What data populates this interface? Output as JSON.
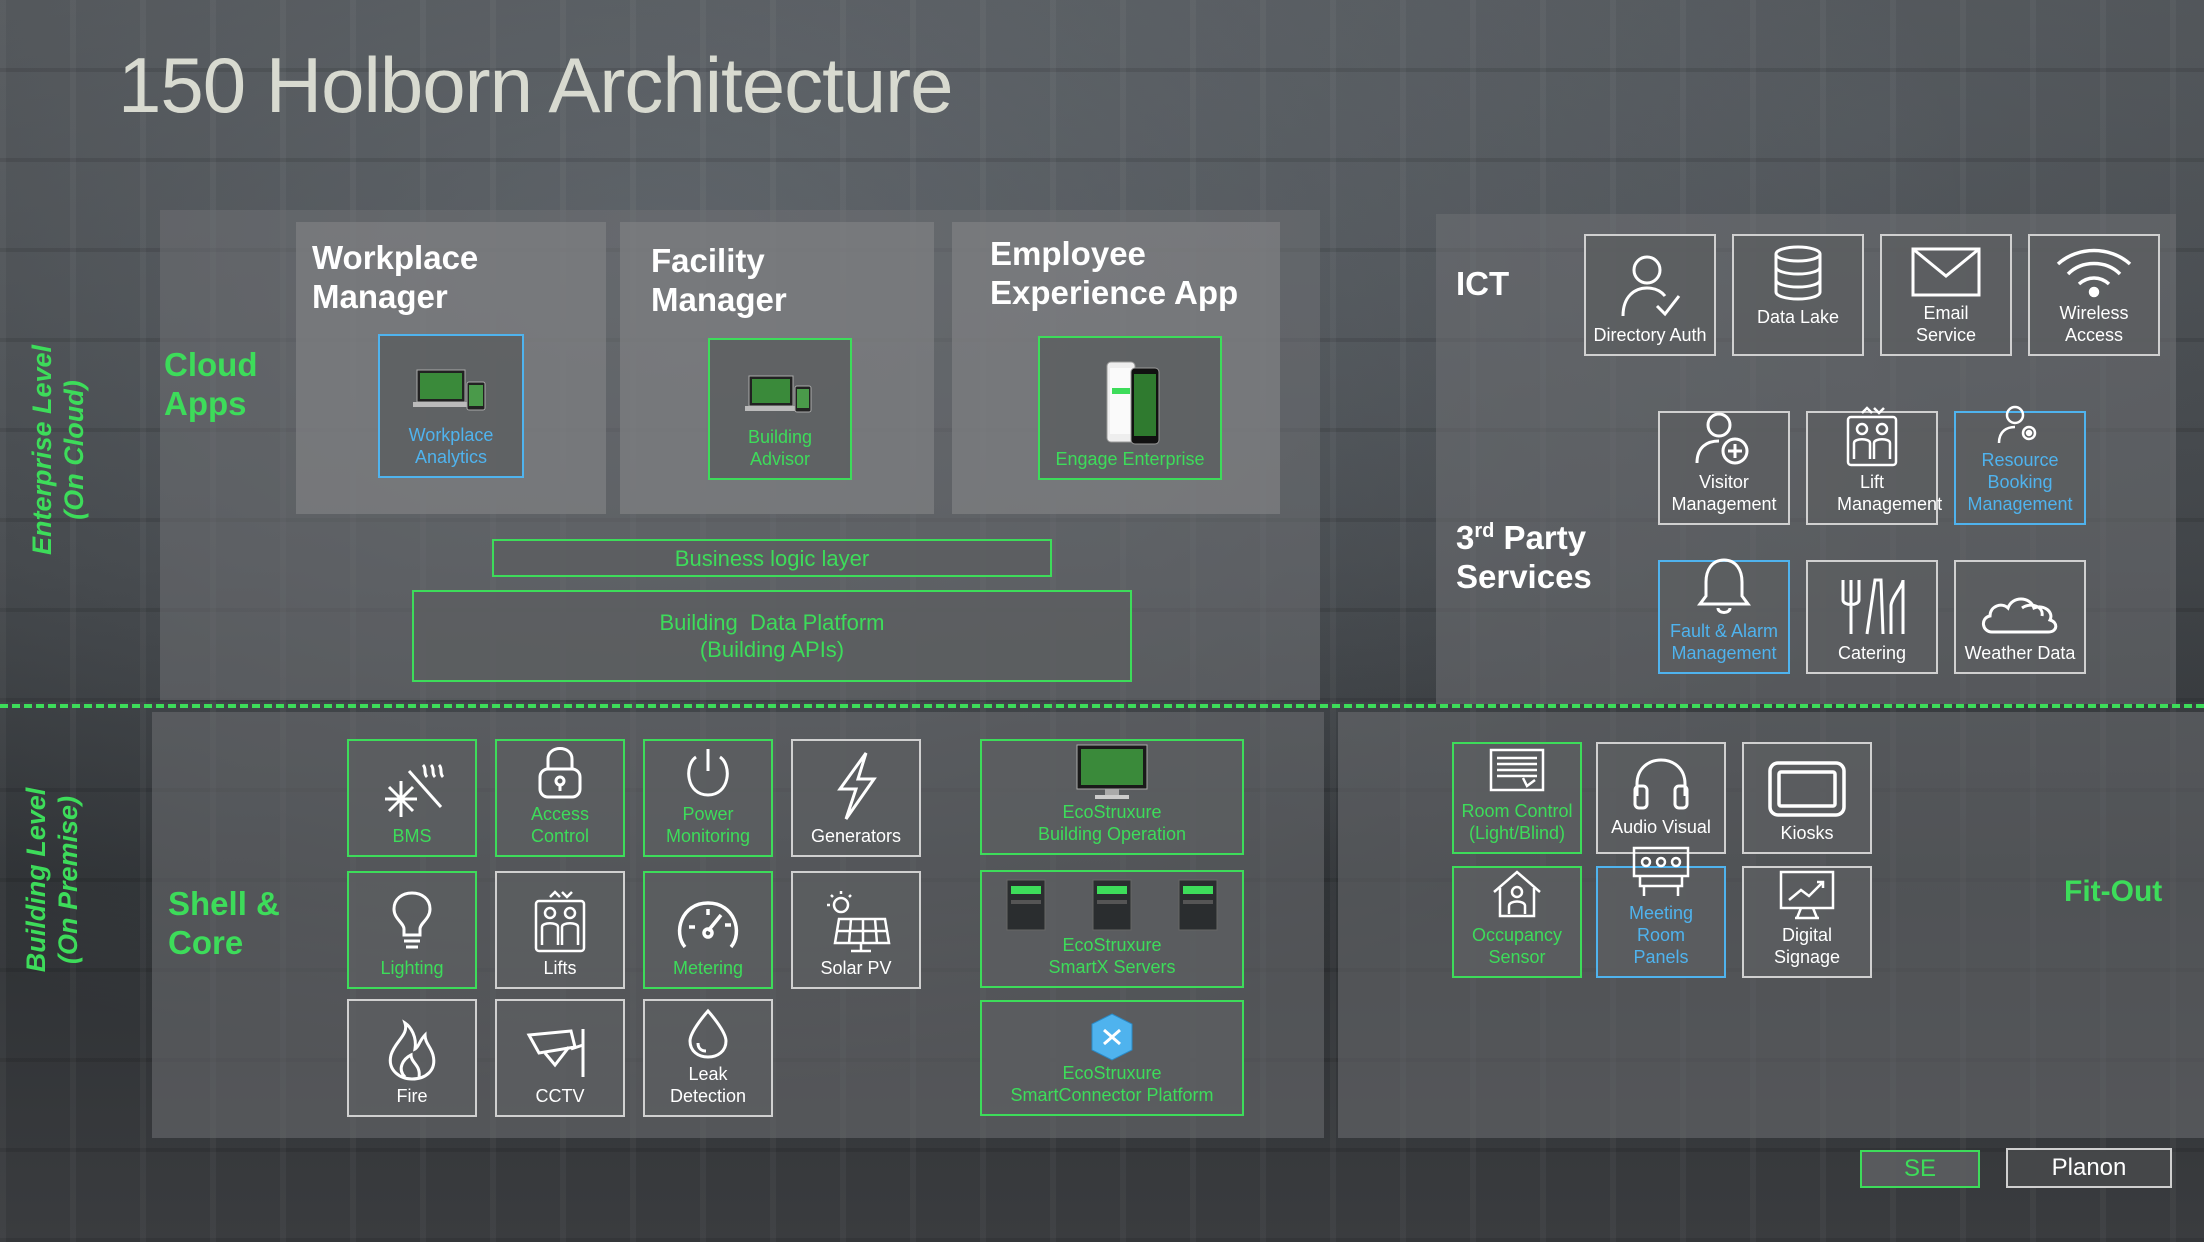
{
  "title": "150 Holborn Architecture",
  "levels": {
    "enterprise": [
      "Enterprise Level",
      "(On Cloud)"
    ],
    "building": [
      "Building Level",
      "(On Premise)"
    ]
  },
  "cloud_apps": {
    "label": [
      "Cloud",
      "Apps"
    ],
    "groups": [
      {
        "heading": [
          "Workplace",
          "Manager"
        ],
        "app": "Workplace Analytics"
      },
      {
        "heading": [
          "Facility",
          "Manager"
        ],
        "app": "Building Advisor"
      },
      {
        "heading": [
          "Employee",
          "Experience App"
        ],
        "app": "Engage Enterprise"
      }
    ],
    "business_logic": "Business logic layer",
    "data_platform": [
      "Building  Data Platform",
      "(Building APIs)"
    ]
  },
  "ict": {
    "label": "ICT",
    "tiles": [
      "Directory Auth",
      "Data Lake",
      "Email Service",
      "Wireless Access"
    ]
  },
  "third_party": {
    "label_main": "3",
    "label_sup": "rd",
    "label_rest": " Party",
    "label_line2": "Services",
    "tiles": [
      "Visitor Management",
      "Lift Management",
      "Resource Booking Management",
      "Fault & Alarm Management",
      "Catering",
      "Weather Data"
    ]
  },
  "shell_core": {
    "label": [
      "Shell &",
      "Core"
    ],
    "tiles": [
      "BMS",
      "Access Control",
      "Power Monitoring",
      "Generators",
      "Lighting",
      "Lifts",
      "Metering",
      "Solar PV",
      "Fire",
      "CCTV",
      "Leak Detection"
    ],
    "eco": [
      [
        "EcoStruxure",
        "Building Operation"
      ],
      [
        "EcoStruxure",
        "SmartX Servers"
      ],
      [
        "EcoStruxure",
        "SmartConnector Platform"
      ]
    ]
  },
  "fit_out": {
    "label": "Fit-Out",
    "tiles": [
      "Room Control (Light/Blind)",
      "Audio Visual",
      "Kiosks",
      "Occupancy Sensor",
      "Meeting Room Panels",
      "Digital Signage"
    ]
  },
  "legend": {
    "se": "SE",
    "planon": "Planon"
  },
  "colors": {
    "green": "#3ddc5a",
    "blue": "#4fb3ee",
    "white": "#ffffff"
  }
}
